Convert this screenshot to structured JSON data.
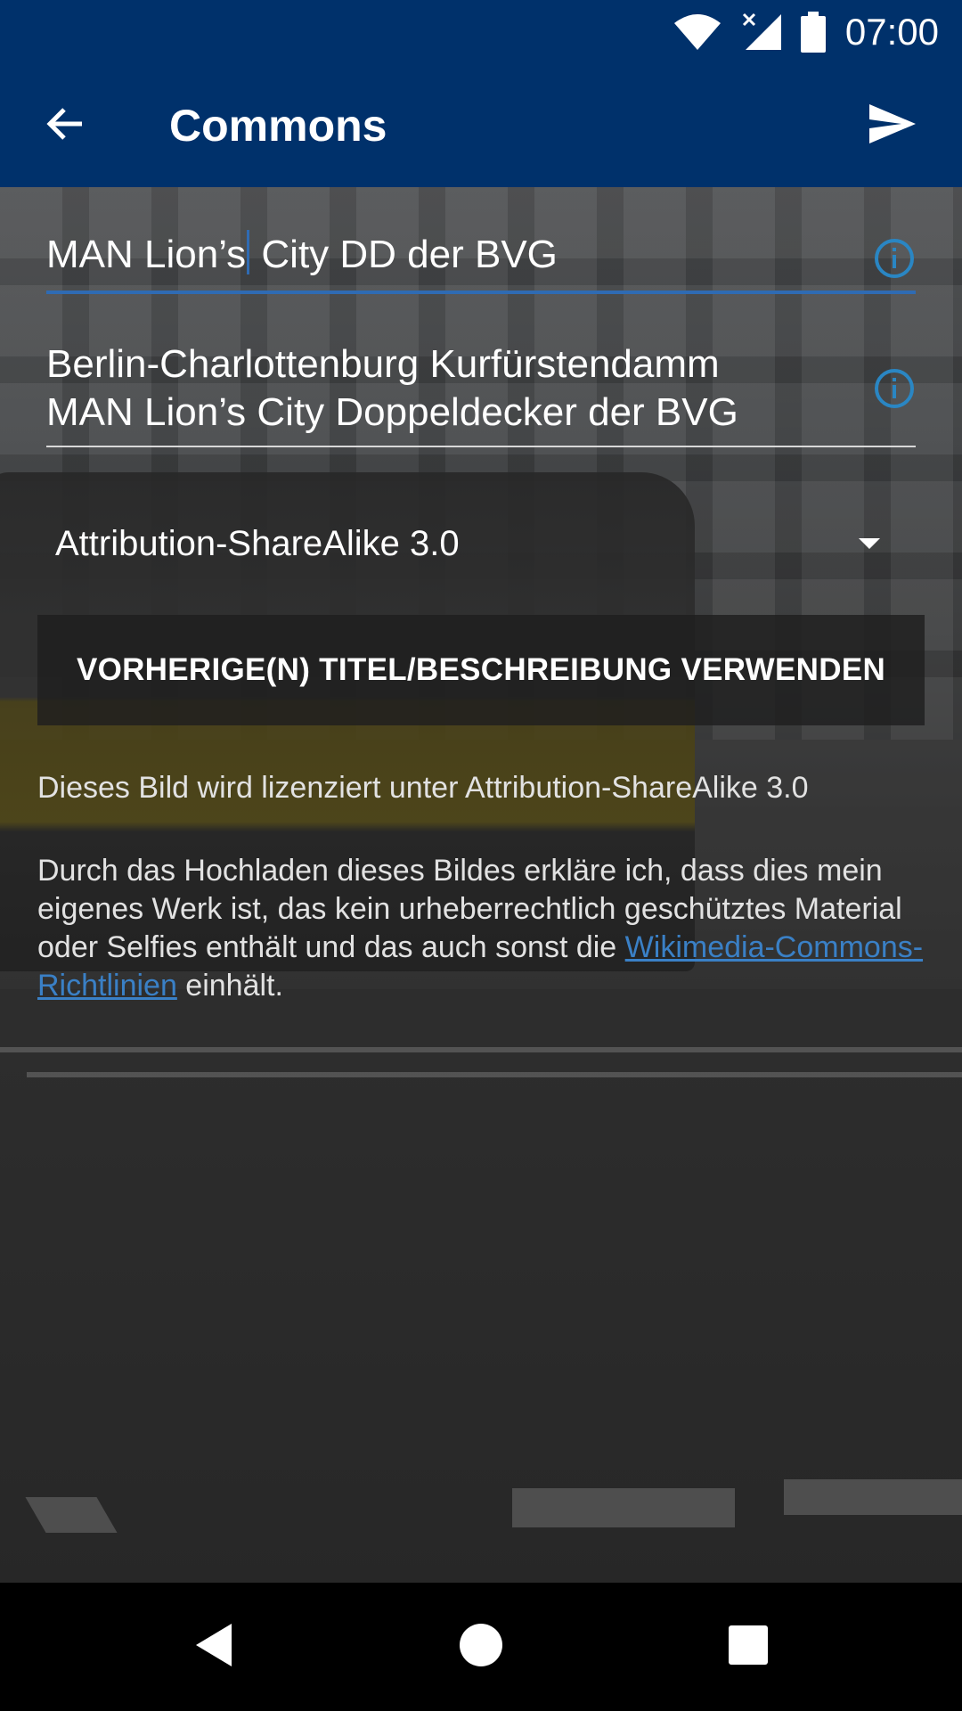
{
  "status_bar": {
    "time": "07:00",
    "icons": [
      "wifi-icon",
      "signal-no-service-icon",
      "battery-icon"
    ]
  },
  "app_bar": {
    "title": "Commons",
    "back_icon": "arrow-left-icon",
    "send_icon": "send-icon"
  },
  "form": {
    "title_value_before_cursor": "MAN Lion’s",
    "title_value_after_cursor": " City DD der BVG",
    "description_line1": "Berlin-Charlottenburg Kurfürstendamm",
    "description_line2": "MAN Lion’s City Doppeldecker der BVG",
    "license_selected": "Attribution-ShareAlike 3.0",
    "prev_button_label": "VORHERIGE(N) TITEL/BESCHREIBUNG VERWENDEN",
    "license_info": "Dieses Bild wird lizenziert unter Attribution-ShareAlike 3.0",
    "declaration_before_link": "Durch das Hochladen dieses Bildes erkläre ich, dass dies mein eigenes Werk ist, das kein urheberrechtlich geschütztes Material oder Selfies enthält und das auch sonst die ",
    "declaration_link": "Wikimedia-Commons-Richtlinien",
    "declaration_after_link": " einhält."
  },
  "colors": {
    "app_bar": "#00316b",
    "accent": "#2f6bb3",
    "link": "#3a80c6",
    "info_icon": "#2a86c3"
  },
  "nav_bar": {
    "icons": [
      "back-triangle-icon",
      "home-circle-icon",
      "recents-square-icon"
    ]
  }
}
